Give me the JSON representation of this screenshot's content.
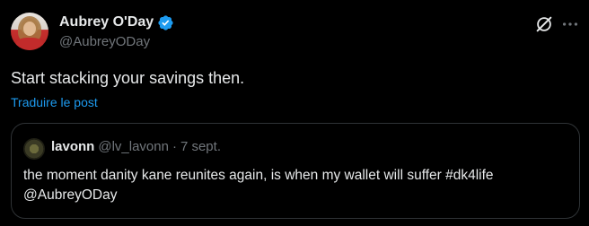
{
  "post": {
    "author": {
      "display_name": "Aubrey O'Day",
      "handle": "@AubreyODay",
      "verified": true
    },
    "text": "Start stacking your savings then.",
    "translate_label": "Traduire le post",
    "icons": {
      "grok": "grok-icon",
      "more": "more-icon",
      "verified": "verified-badge-icon"
    }
  },
  "quote": {
    "display_name": "lavonn",
    "handle": "@lv_lavonn",
    "separator": "·",
    "time": "7 sept.",
    "text_line1": "the moment danity kane reunites again, is when my wallet will suffer #dk4life",
    "text_line2": "@AubreyODay"
  },
  "colors": {
    "background": "#000000",
    "text": "#e7e9ea",
    "secondary_text": "#71767b",
    "link": "#1d9bf0",
    "border": "#2f3336"
  }
}
